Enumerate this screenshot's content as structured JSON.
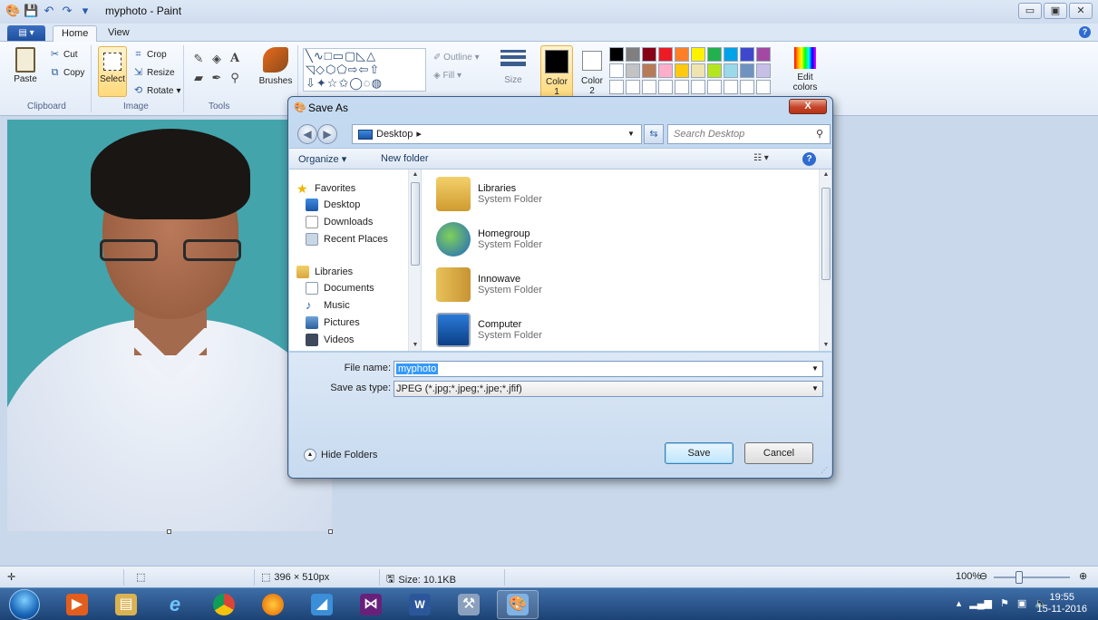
{
  "window": {
    "title": "myphoto - Paint",
    "controls": {
      "minimize": "▭",
      "maximize": "▣",
      "close": "✕"
    }
  },
  "ribbon": {
    "tabs": [
      {
        "label": "Home",
        "active": true
      },
      {
        "label": "View",
        "active": false
      }
    ],
    "clipboard": {
      "paste": "Paste",
      "cut": "Cut",
      "copy": "Copy",
      "group": "Clipboard"
    },
    "image": {
      "crop": "Crop",
      "resize": "Resize",
      "rotate": "Rotate",
      "select": "Select",
      "group": "Image"
    },
    "tools": {
      "group": "Tools",
      "brushes": "Brushes"
    },
    "shapes": {
      "outline": "Outline",
      "fill": "Fill"
    },
    "size": "Size",
    "color1": {
      "label": "Color",
      "number": "1"
    },
    "color2": {
      "label": "Color",
      "number": "2"
    },
    "edit_colors": "Edit colors",
    "palette": [
      "#000000",
      "#7f7f7f",
      "#880015",
      "#ed1c24",
      "#ff7f27",
      "#fff200",
      "#22b14c",
      "#00a2e8",
      "#3f48cc",
      "#a349a4",
      "#ffffff",
      "#c3c3c3",
      "#b97a57",
      "#ffaec9",
      "#ffc90e",
      "#efe4b0",
      "#b5e61d",
      "#99d9ea",
      "#7092be",
      "#c8bfe7",
      "#ffffff",
      "#ffffff",
      "#ffffff",
      "#ffffff",
      "#ffffff",
      "#ffffff",
      "#ffffff",
      "#ffffff",
      "#ffffff",
      "#ffffff"
    ]
  },
  "status": {
    "dimensions": "396 × 510px",
    "size": "Size: 10.1KB",
    "zoom": "100%"
  },
  "taskbar": {
    "time": "19:55",
    "date": "15-11-2016"
  },
  "dialog": {
    "title": "Save As",
    "close": "X",
    "address": "Desktop",
    "search_placeholder": "Search Desktop",
    "organize": "Organize ▾",
    "new_folder": "New folder",
    "nav": {
      "favorites": "Favorites",
      "desktop": "Desktop",
      "downloads": "Downloads",
      "recent": "Recent Places",
      "libraries": "Libraries",
      "documents": "Documents",
      "music": "Music",
      "pictures": "Pictures",
      "videos": "Videos"
    },
    "files": [
      {
        "name": "Libraries",
        "type": "System Folder"
      },
      {
        "name": "Homegroup",
        "type": "System Folder"
      },
      {
        "name": "Innowave",
        "type": "System Folder"
      },
      {
        "name": "Computer",
        "type": "System Folder"
      }
    ],
    "file_name_label": "File name:",
    "file_name_value": "myphoto",
    "save_type_label": "Save as type:",
    "save_type_value": "JPEG (*.jpg;*.jpeg;*.jpe;*.jfif)",
    "hide_folders": "Hide Folders",
    "save": "Save",
    "cancel": "Cancel"
  }
}
